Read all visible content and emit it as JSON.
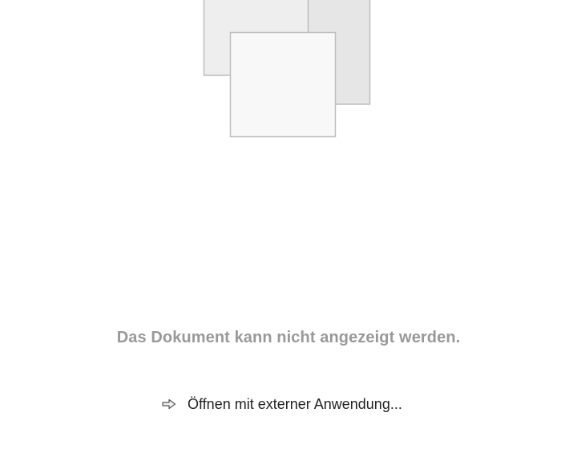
{
  "message": {
    "text": "Das Dokument kann nicht angezeigt werden."
  },
  "action": {
    "label": "Öffnen mit externer Anwendung...",
    "icon": "arrow-right-icon"
  },
  "colors": {
    "message": "#999999",
    "action_text": "#222222",
    "page_front": "#f8f8f8",
    "page_middle": "#eeeeee",
    "page_back": "#e6e6e6",
    "page_border": "#bdbdbd"
  }
}
